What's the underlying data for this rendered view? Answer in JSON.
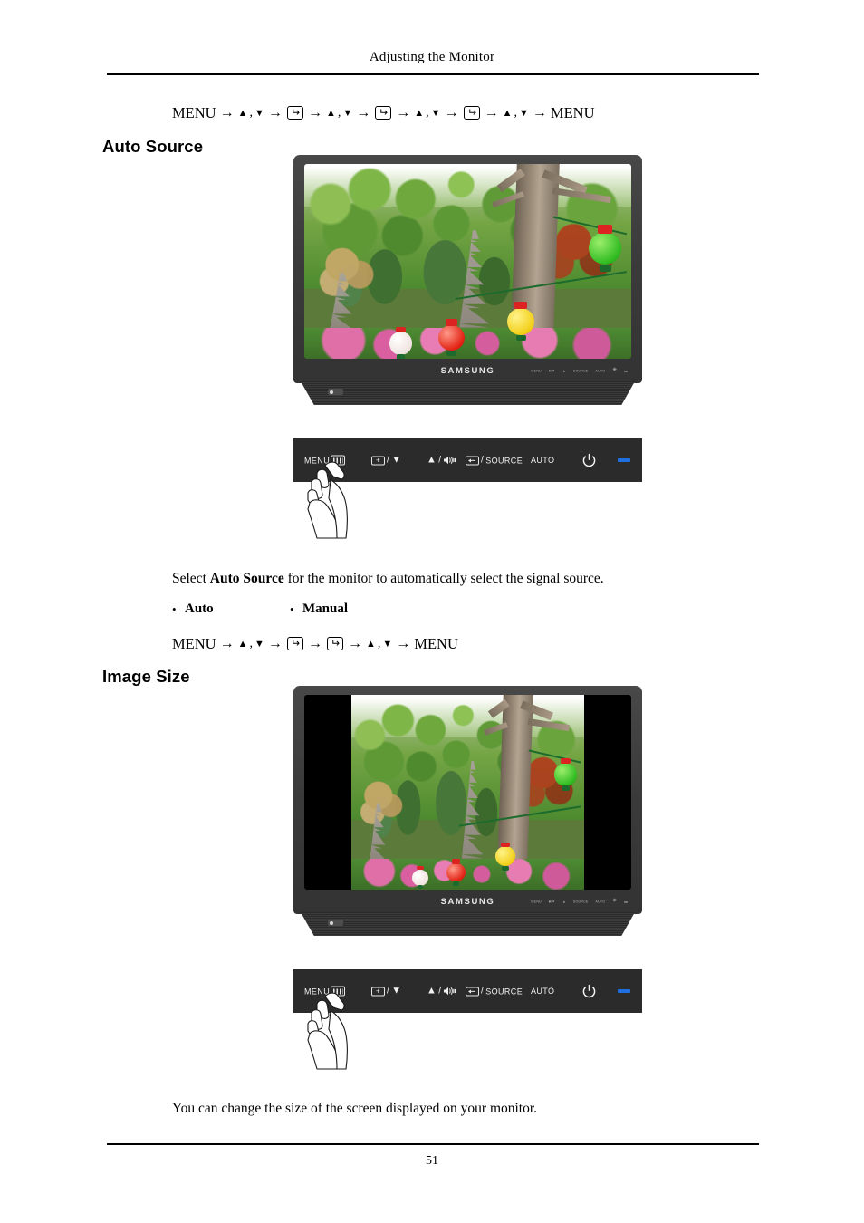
{
  "page": {
    "header_title": "Adjusting the Monitor",
    "page_number": "51"
  },
  "nav_paths": {
    "auto_source_top": {
      "start": "MENU",
      "end": "MENU",
      "tokens": [
        "MENU",
        "arrow",
        "up-down",
        "arrow",
        "enter",
        "arrow",
        "up-down",
        "arrow",
        "enter",
        "arrow",
        "up-down",
        "arrow",
        "enter",
        "arrow",
        "up-down",
        "arrow",
        "MENU"
      ],
      "up_glyph": "▲",
      "down_glyph": "▼",
      "comma": ",",
      "arrow_glyph": "→"
    },
    "image_size_top": {
      "start": "MENU",
      "end": "MENU",
      "tokens": [
        "MENU",
        "arrow",
        "up-down",
        "arrow",
        "enter",
        "arrow",
        "enter",
        "arrow",
        "up-down",
        "arrow",
        "MENU"
      ]
    }
  },
  "sections": [
    {
      "id": "auto-source",
      "heading": "Auto Source",
      "description_prefix": "Select ",
      "description_bold": "Auto Source",
      "description_suffix": " for the monitor to automatically select the signal source.",
      "options": [
        {
          "bullet": "•",
          "label": "Auto"
        },
        {
          "bullet": "•",
          "label": "Manual"
        }
      ],
      "monitor": {
        "brand": "SAMSUNG",
        "screen_mode": "full-wide",
        "picture_subject": "garden with stone pagodas, trees and paper lanterns"
      }
    },
    {
      "id": "image-size",
      "heading": "Image Size",
      "description": "You can change the size of the screen displayed on your monitor.",
      "monitor": {
        "brand": "SAMSUNG",
        "screen_mode": "pillarboxed-4-3",
        "picture_subject": "garden with stone pagodas, trees and paper lanterns"
      }
    }
  ],
  "control_panel": {
    "buttons": [
      {
        "name": "menu",
        "label": "MENU",
        "icon": "menu-box-icon"
      },
      {
        "name": "down",
        "label": "",
        "icon": "plus-box-icon",
        "separator": "/",
        "glyph": "▼"
      },
      {
        "name": "up",
        "label": "",
        "glyph": "▲",
        "separator": "/",
        "icon": "speaker-icon"
      },
      {
        "name": "source",
        "label": "SOURCE",
        "icon": "enter-box-icon",
        "separator": "/"
      },
      {
        "name": "auto",
        "label": "AUTO",
        "icon": ""
      },
      {
        "name": "power",
        "label": "",
        "icon": "power-icon"
      },
      {
        "name": "led",
        "label": "",
        "icon": "power-led-indicator"
      }
    ],
    "led_color": "#1f6fe0",
    "panel_color": "#2b2b2b"
  },
  "colors": {
    "page_background": "#ffffff",
    "text": "#000000",
    "monitor_bezel": "#3b3b3b",
    "screen_black": "#000000",
    "led_blue": "#1f6fe0"
  },
  "hand_pointer": {
    "description": "line-drawn hand pressing the MENU button",
    "target_button": "MENU"
  }
}
